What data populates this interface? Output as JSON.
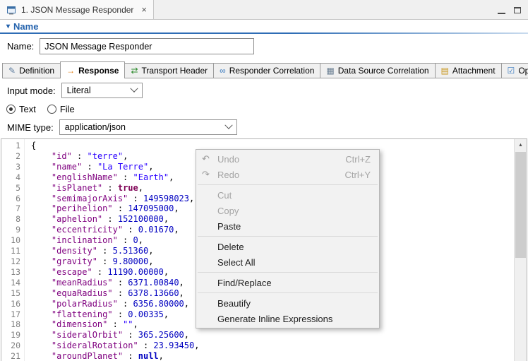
{
  "editor_tab": {
    "title": "1. JSON Message Responder",
    "close_glyph": "×"
  },
  "section": {
    "collapse_glyph": "▾",
    "title": "Name"
  },
  "name_field": {
    "label": "Name:",
    "value": "JSON Message Responder"
  },
  "config_tabs": [
    {
      "label": "Definition",
      "icon": "definition-icon",
      "glyph": "✎",
      "color": "#5f7d9e",
      "active": false
    },
    {
      "label": "Response",
      "icon": "response-icon",
      "glyph": "→",
      "color": "#e07b10",
      "active": true
    },
    {
      "label": "Transport Header",
      "icon": "transport-header-icon",
      "glyph": "⇄",
      "color": "#2e8b2e",
      "active": false
    },
    {
      "label": "Responder Correlation",
      "icon": "responder-correlation-icon",
      "glyph": "∞",
      "color": "#3a7abf",
      "active": false
    },
    {
      "label": "Data Source Correlation",
      "icon": "data-source-correlation-icon",
      "glyph": "▦",
      "color": "#6b7f93",
      "active": false
    },
    {
      "label": "Attachment",
      "icon": "attachment-icon",
      "glyph": "▤",
      "color": "#c8961e",
      "active": false
    },
    {
      "label": "Options",
      "icon": "options-icon",
      "glyph": "☑",
      "color": "#3a7abf",
      "active": false
    }
  ],
  "input_mode": {
    "label": "Input mode:",
    "value": "Literal"
  },
  "source": {
    "options": [
      {
        "label": "Text",
        "selected": true
      },
      {
        "label": "File",
        "selected": false
      }
    ]
  },
  "mime_type": {
    "label": "MIME type:",
    "value": "application/json"
  },
  "editor": {
    "lines": [
      [
        [
          "p",
          "{"
        ]
      ],
      [
        [
          "p",
          "    "
        ],
        [
          "k",
          "\"id\""
        ],
        [
          "p",
          " : "
        ],
        [
          "s",
          "\"terre\""
        ],
        [
          "p",
          ","
        ]
      ],
      [
        [
          "p",
          "    "
        ],
        [
          "k",
          "\"name\""
        ],
        [
          "p",
          " : "
        ],
        [
          "s",
          "\"La Terre\""
        ],
        [
          "p",
          ","
        ]
      ],
      [
        [
          "p",
          "    "
        ],
        [
          "k",
          "\"englishName\""
        ],
        [
          "p",
          " : "
        ],
        [
          "s",
          "\"Earth\""
        ],
        [
          "p",
          ","
        ]
      ],
      [
        [
          "p",
          "    "
        ],
        [
          "k",
          "\"isPlanet\""
        ],
        [
          "p",
          " : "
        ],
        [
          "b",
          "true"
        ],
        [
          "p",
          ","
        ]
      ],
      [
        [
          "p",
          "    "
        ],
        [
          "k",
          "\"semimajorAxis\""
        ],
        [
          "p",
          " : "
        ],
        [
          "n",
          "149598023"
        ],
        [
          "p",
          ","
        ]
      ],
      [
        [
          "p",
          "    "
        ],
        [
          "k",
          "\"perihelion\""
        ],
        [
          "p",
          " : "
        ],
        [
          "n",
          "147095000"
        ],
        [
          "p",
          ","
        ]
      ],
      [
        [
          "p",
          "    "
        ],
        [
          "k",
          "\"aphelion\""
        ],
        [
          "p",
          " : "
        ],
        [
          "n",
          "152100000"
        ],
        [
          "p",
          ","
        ]
      ],
      [
        [
          "p",
          "    "
        ],
        [
          "k",
          "\"eccentricity\""
        ],
        [
          "p",
          " : "
        ],
        [
          "n",
          "0.01670"
        ],
        [
          "p",
          ","
        ]
      ],
      [
        [
          "p",
          "    "
        ],
        [
          "k",
          "\"inclination\""
        ],
        [
          "p",
          " : "
        ],
        [
          "n",
          "0"
        ],
        [
          "p",
          ","
        ]
      ],
      [
        [
          "p",
          "    "
        ],
        [
          "k",
          "\"density\""
        ],
        [
          "p",
          " : "
        ],
        [
          "n",
          "5.51360"
        ],
        [
          "p",
          ","
        ]
      ],
      [
        [
          "p",
          "    "
        ],
        [
          "k",
          "\"gravity\""
        ],
        [
          "p",
          " : "
        ],
        [
          "n",
          "9.80000"
        ],
        [
          "p",
          ","
        ]
      ],
      [
        [
          "p",
          "    "
        ],
        [
          "k",
          "\"escape\""
        ],
        [
          "p",
          " : "
        ],
        [
          "n",
          "11190.00000"
        ],
        [
          "p",
          ","
        ]
      ],
      [
        [
          "p",
          "    "
        ],
        [
          "k",
          "\"meanRadius\""
        ],
        [
          "p",
          " : "
        ],
        [
          "n",
          "6371.00840"
        ],
        [
          "p",
          ","
        ]
      ],
      [
        [
          "p",
          "    "
        ],
        [
          "k",
          "\"equaRadius\""
        ],
        [
          "p",
          " : "
        ],
        [
          "n",
          "6378.13660"
        ],
        [
          "p",
          ","
        ]
      ],
      [
        [
          "p",
          "    "
        ],
        [
          "k",
          "\"polarRadius\""
        ],
        [
          "p",
          " : "
        ],
        [
          "n",
          "6356.80000"
        ],
        [
          "p",
          ","
        ]
      ],
      [
        [
          "p",
          "    "
        ],
        [
          "k",
          "\"flattening\""
        ],
        [
          "p",
          " : "
        ],
        [
          "n",
          "0.00335"
        ],
        [
          "p",
          ","
        ]
      ],
      [
        [
          "p",
          "    "
        ],
        [
          "k",
          "\"dimension\""
        ],
        [
          "p",
          " : "
        ],
        [
          "s",
          "\"\""
        ],
        [
          "p",
          ","
        ]
      ],
      [
        [
          "p",
          "    "
        ],
        [
          "k",
          "\"sideralOrbit\""
        ],
        [
          "p",
          " : "
        ],
        [
          "n",
          "365.25600"
        ],
        [
          "p",
          ","
        ]
      ],
      [
        [
          "p",
          "    "
        ],
        [
          "k",
          "\"sideralRotation\""
        ],
        [
          "p",
          " : "
        ],
        [
          "n",
          "23.93450"
        ],
        [
          "p",
          ","
        ]
      ],
      [
        [
          "p",
          "    "
        ],
        [
          "k",
          "\"aroundPlanet\""
        ],
        [
          "p",
          " : "
        ],
        [
          "u",
          "null"
        ],
        [
          "p",
          ","
        ]
      ]
    ]
  },
  "scrollbar": {
    "up_glyph": "▲"
  },
  "context_menu": {
    "items": [
      {
        "label": "Undo",
        "shortcut": "Ctrl+Z",
        "icon": "undo-icon",
        "glyph": "↶",
        "enabled": false
      },
      {
        "label": "Redo",
        "shortcut": "Ctrl+Y",
        "icon": "redo-icon",
        "glyph": "↷",
        "enabled": false
      },
      {
        "sep": true
      },
      {
        "label": "Cut",
        "enabled": false
      },
      {
        "label": "Copy",
        "enabled": false
      },
      {
        "label": "Paste",
        "enabled": true
      },
      {
        "sep": true
      },
      {
        "label": "Delete",
        "enabled": true
      },
      {
        "label": "Select All",
        "enabled": true
      },
      {
        "sep": true
      },
      {
        "label": "Find/Replace",
        "enabled": true
      },
      {
        "sep": true
      },
      {
        "label": "Beautify",
        "enabled": true
      },
      {
        "label": "Generate Inline Expressions",
        "enabled": true
      }
    ]
  }
}
